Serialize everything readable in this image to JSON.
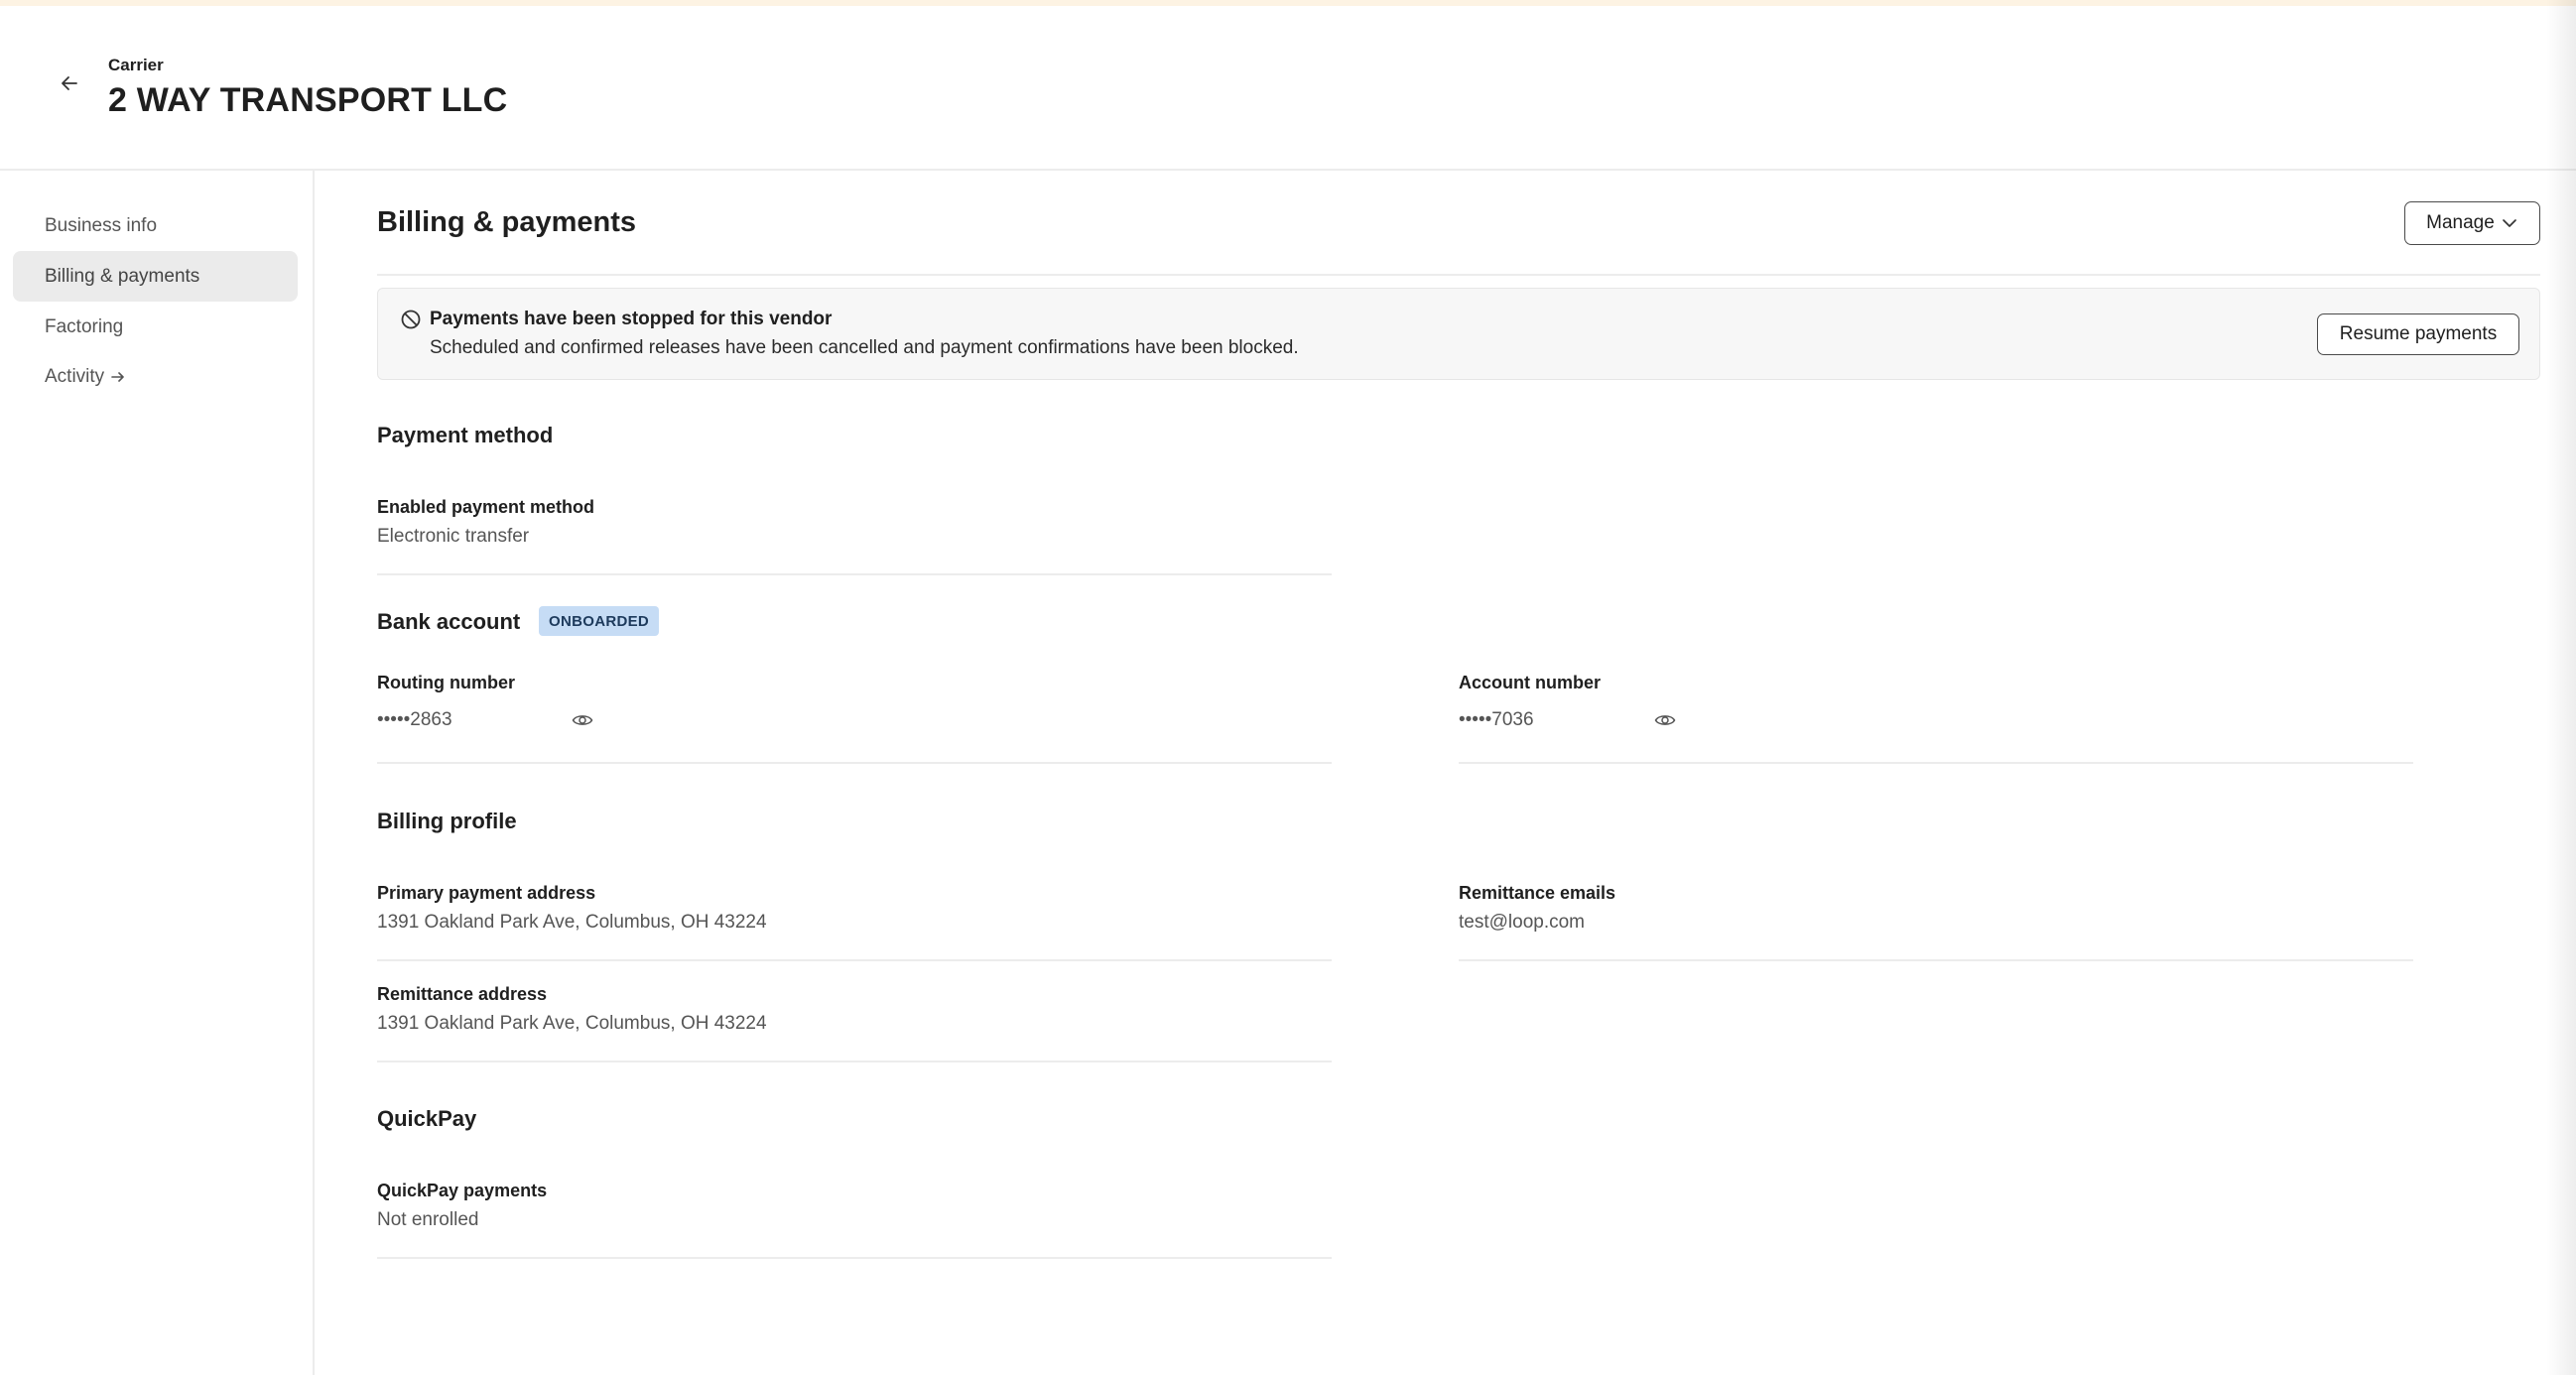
{
  "header": {
    "eyebrow": "Carrier",
    "title": "2 WAY TRANSPORT LLC"
  },
  "sidebar": {
    "items": [
      {
        "label": "Business info",
        "active": false
      },
      {
        "label": "Billing & payments",
        "active": true
      },
      {
        "label": "Factoring",
        "active": false
      },
      {
        "label": "Activity",
        "active": false,
        "icon": "arrow-right-icon"
      }
    ]
  },
  "page": {
    "title": "Billing & payments",
    "manage_label": "Manage"
  },
  "banner": {
    "icon": "blocked-icon",
    "title": "Payments have been stopped for this vendor",
    "body": "Scheduled and confirmed releases have been cancelled and payment confirmations have been blocked.",
    "action_label": "Resume payments"
  },
  "payment_method": {
    "heading": "Payment method",
    "label": "Enabled payment method",
    "value": "Electronic transfer"
  },
  "bank_account": {
    "heading": "Bank account",
    "badge": "ONBOARDED",
    "routing_label": "Routing number",
    "routing_value": "•••••2863",
    "account_label": "Account number",
    "account_value": "•••••7036"
  },
  "billing_profile": {
    "heading": "Billing profile",
    "primary_address_label": "Primary payment address",
    "primary_address_value": "1391 Oakland Park Ave, Columbus, OH 43224",
    "remittance_emails_label": "Remittance emails",
    "remittance_emails_value": "test@loop.com",
    "remittance_address_label": "Remittance address",
    "remittance_address_value": "1391 Oakland Park Ave, Columbus, OH 43224"
  },
  "quickpay": {
    "heading": "QuickPay",
    "label": "QuickPay payments",
    "value": "Not enrolled"
  },
  "colors": {
    "accent_badge_bg": "#c6dcf5",
    "active_nav_bg": "#ebebeb",
    "divider": "#ececec"
  }
}
